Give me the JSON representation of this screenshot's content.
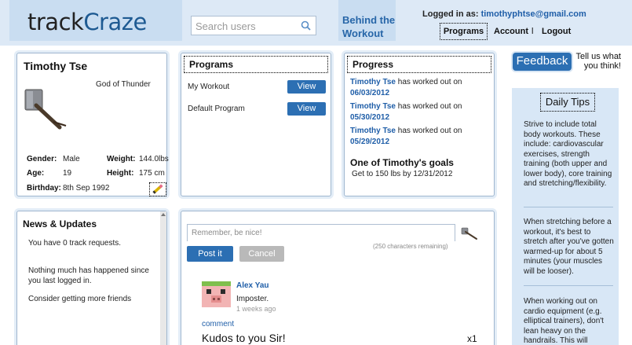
{
  "header": {
    "logo_track": "track",
    "logo_craze": "Craze",
    "search_placeholder": "Search users",
    "behind_line1": "Behind the",
    "behind_line2": "Workout",
    "logged_in_label": "Logged in as:",
    "logged_in_email": "timothyphtse@gmail.com",
    "nav": {
      "programs": "Programs",
      "account": "Account",
      "separator": "l",
      "logout": "Logout"
    }
  },
  "profile": {
    "name": "Timothy Tse",
    "title": "God of Thunder",
    "gender_label": "Gender:",
    "gender": "Male",
    "weight_label": "Weight:",
    "weight": "144.0lbs",
    "age_label": "Age:",
    "age": "19",
    "height_label": "Height:",
    "height": "175 cm",
    "birthday_label": "Birthday:",
    "birthday": "8th Sep 1992"
  },
  "programs": {
    "title": "Programs",
    "items": [
      {
        "name": "My Workout",
        "button": "View"
      },
      {
        "name": "Default Program",
        "button": "View"
      }
    ]
  },
  "progress": {
    "title": "Progress",
    "entries": [
      {
        "who": "Timothy Tse",
        "text": " has worked out on",
        "date": "06/03/2012"
      },
      {
        "who": "Timothy Tse",
        "text": " has worked out on",
        "date": "05/30/2012"
      },
      {
        "who": "Timothy Tse",
        "text": " has worked out on",
        "date": "05/29/2012"
      }
    ],
    "goals_title": "One of Timothy's goals",
    "goal": "Get to 150 lbs by 12/31/2012"
  },
  "news": {
    "title": "News & Updates",
    "items": [
      "You have 0 track requests.",
      "Nothing much has happened since you last logged in.",
      "Consider getting more friends"
    ]
  },
  "post": {
    "placeholder": "Remember, be nice!",
    "chars_remaining": "(250 characters remaining)",
    "post_button": "Post it",
    "cancel_button": "Cancel",
    "comment": {
      "author": "Alex Yau",
      "text": "Imposter.",
      "time": "1 weeks ago",
      "link": "comment"
    },
    "kudos": "Kudos to you Sir!",
    "kudos_count": "x1"
  },
  "sidebar": {
    "feedback_button": "Feedback",
    "feedback_tagline": "Tell us what you think!",
    "tips_title": "Daily Tips",
    "tips": [
      "Strive to include total body workouts. These include: cardiovascular exercises, strength training (both upper and lower body), core training and stretching/flexibility.",
      "When stretching before a workout, it's best to stretch after you've gotten warmed-up for about 5 minutes (your muscles will be looser).",
      "When working out on cardio equipment (e.g. elliptical trainers), don't lean heavy on the handrails. This will"
    ]
  },
  "colors": {
    "accent": "#2c6fb3",
    "link": "#1f5ea8",
    "header_bg": "#dde9f6",
    "panel_border": "#9fb6cf"
  }
}
